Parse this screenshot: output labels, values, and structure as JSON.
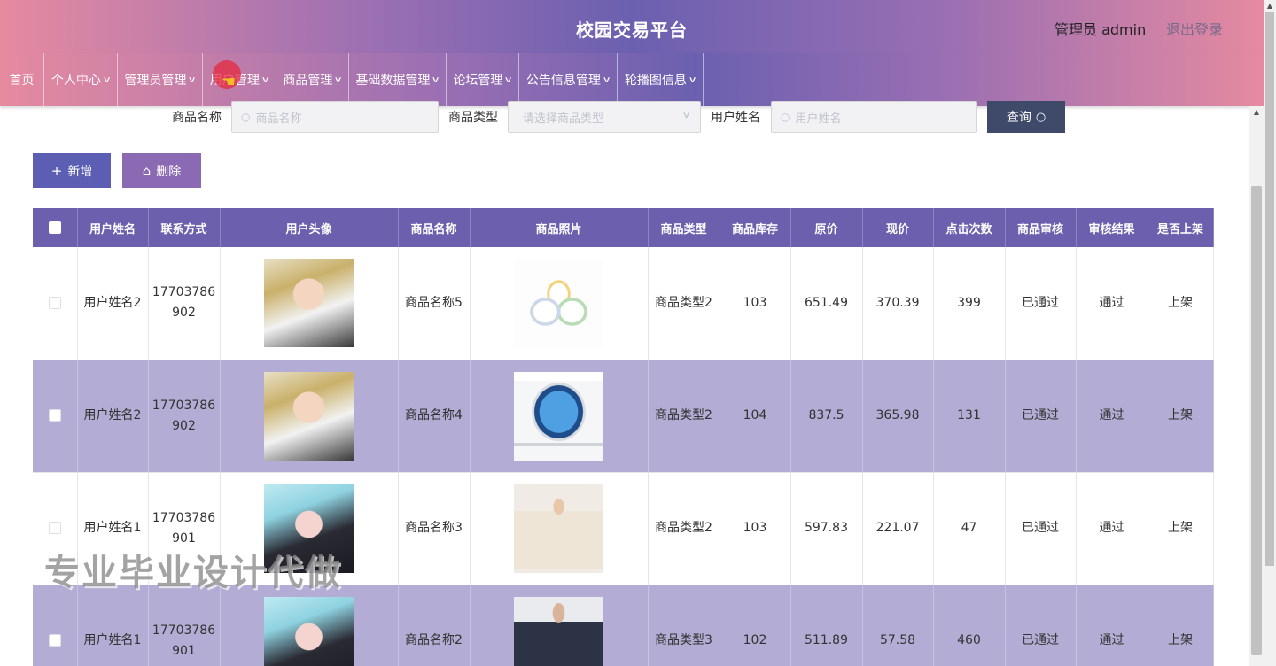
{
  "header": {
    "title": "校园交易平台",
    "admin_label": "管理员 admin",
    "logout": "退出登录"
  },
  "nav": {
    "items": [
      "首页",
      "个人中心",
      "管理员管理",
      "用户管理",
      "商品管理",
      "基础数据管理",
      "论坛管理",
      "公告信息管理",
      "轮播图信息"
    ]
  },
  "search": {
    "product_name_label": "商品名称",
    "product_name_placeholder": "商品名称",
    "product_type_label": "商品类型",
    "product_type_placeholder": "请选择商品类型",
    "username_label": "用户姓名",
    "username_placeholder": "用户姓名",
    "query_label": "查询"
  },
  "toolbar": {
    "add_label": "新增",
    "delete_label": "删除"
  },
  "table": {
    "headers": [
      "用户姓名",
      "联系方式",
      "用户头像",
      "商品名称",
      "商品照片",
      "商品类型",
      "商品库存",
      "原价",
      "现价",
      "点击次数",
      "商品审核",
      "审核结果",
      "是否上架"
    ],
    "rows": [
      {
        "user": "用户姓名2",
        "phone": "17703786902",
        "product": "商品名称5",
        "type": "商品类型2",
        "stock": "103",
        "orig": "651.49",
        "now": "370.39",
        "clicks": "399",
        "audit": "已通过",
        "result": "通过",
        "shelf": "上架"
      },
      {
        "user": "用户姓名2",
        "phone": "17703786902",
        "product": "商品名称4",
        "type": "商品类型2",
        "stock": "104",
        "orig": "837.5",
        "now": "365.98",
        "clicks": "131",
        "audit": "已通过",
        "result": "通过",
        "shelf": "上架"
      },
      {
        "user": "用户姓名1",
        "phone": "17703786901",
        "product": "商品名称3",
        "type": "商品类型2",
        "stock": "103",
        "orig": "597.83",
        "now": "221.07",
        "clicks": "47",
        "audit": "已通过",
        "result": "通过",
        "shelf": "上架"
      },
      {
        "user": "用户姓名1",
        "phone": "17703786901",
        "product": "商品名称2",
        "type": "商品类型3",
        "stock": "102",
        "orig": "511.89",
        "now": "57.58",
        "clicks": "460",
        "audit": "已通过",
        "result": "通过",
        "shelf": "上架"
      }
    ]
  },
  "watermark": "专业毕业设计代做"
}
